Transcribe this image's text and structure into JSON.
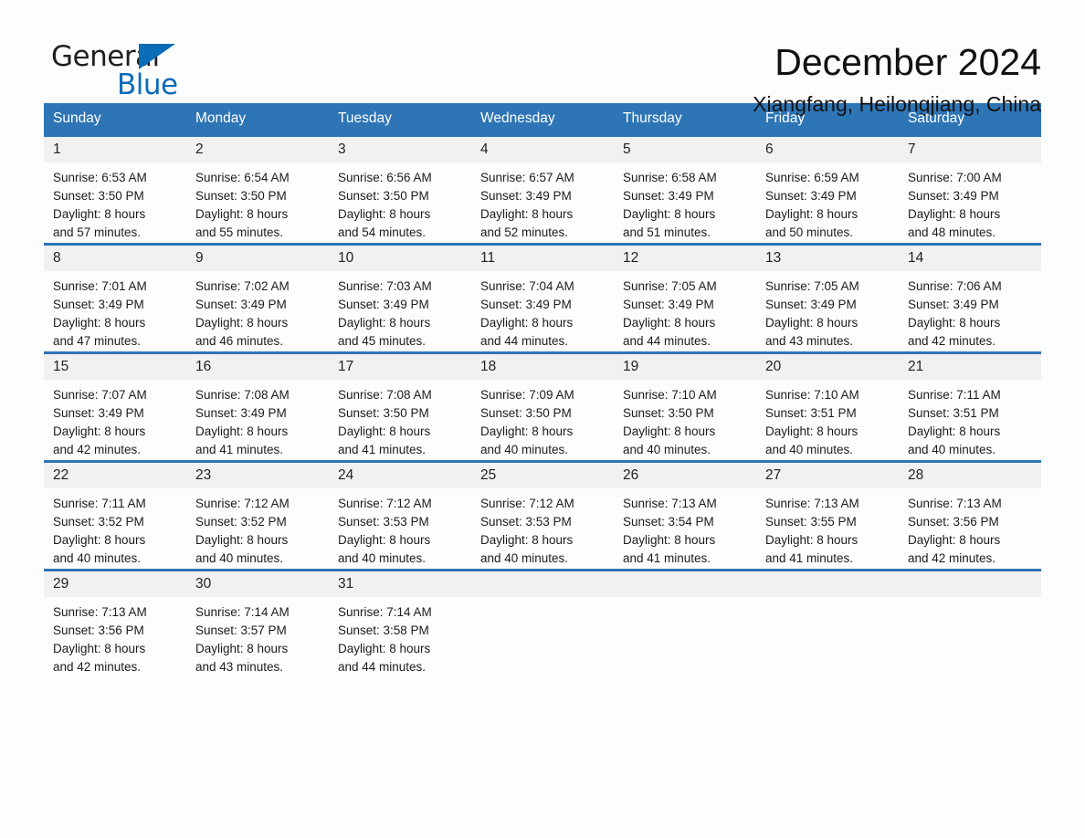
{
  "logo": {
    "word_one": "General",
    "word_two": "Blue",
    "triangle_color": "#0b6cb7"
  },
  "header": {
    "title": "December 2024",
    "location": "Xiangfang, Heilongjiang, China"
  },
  "theme": {
    "header_blue": "#2e75b6",
    "daynum_gray": "#f1f1f1",
    "page_background": "#fdfdfd"
  },
  "calendar": {
    "weekday_headers": [
      "Sunday",
      "Monday",
      "Tuesday",
      "Wednesday",
      "Thursday",
      "Friday",
      "Saturday"
    ],
    "weeks": [
      [
        {
          "day": "1",
          "sunrise": "Sunrise: 6:53 AM",
          "sunset": "Sunset: 3:50 PM",
          "daylight_line1": "Daylight: 8 hours",
          "daylight_line2": "and 57 minutes."
        },
        {
          "day": "2",
          "sunrise": "Sunrise: 6:54 AM",
          "sunset": "Sunset: 3:50 PM",
          "daylight_line1": "Daylight: 8 hours",
          "daylight_line2": "and 55 minutes."
        },
        {
          "day": "3",
          "sunrise": "Sunrise: 6:56 AM",
          "sunset": "Sunset: 3:50 PM",
          "daylight_line1": "Daylight: 8 hours",
          "daylight_line2": "and 54 minutes."
        },
        {
          "day": "4",
          "sunrise": "Sunrise: 6:57 AM",
          "sunset": "Sunset: 3:49 PM",
          "daylight_line1": "Daylight: 8 hours",
          "daylight_line2": "and 52 minutes."
        },
        {
          "day": "5",
          "sunrise": "Sunrise: 6:58 AM",
          "sunset": "Sunset: 3:49 PM",
          "daylight_line1": "Daylight: 8 hours",
          "daylight_line2": "and 51 minutes."
        },
        {
          "day": "6",
          "sunrise": "Sunrise: 6:59 AM",
          "sunset": "Sunset: 3:49 PM",
          "daylight_line1": "Daylight: 8 hours",
          "daylight_line2": "and 50 minutes."
        },
        {
          "day": "7",
          "sunrise": "Sunrise: 7:00 AM",
          "sunset": "Sunset: 3:49 PM",
          "daylight_line1": "Daylight: 8 hours",
          "daylight_line2": "and 48 minutes."
        }
      ],
      [
        {
          "day": "8",
          "sunrise": "Sunrise: 7:01 AM",
          "sunset": "Sunset: 3:49 PM",
          "daylight_line1": "Daylight: 8 hours",
          "daylight_line2": "and 47 minutes."
        },
        {
          "day": "9",
          "sunrise": "Sunrise: 7:02 AM",
          "sunset": "Sunset: 3:49 PM",
          "daylight_line1": "Daylight: 8 hours",
          "daylight_line2": "and 46 minutes."
        },
        {
          "day": "10",
          "sunrise": "Sunrise: 7:03 AM",
          "sunset": "Sunset: 3:49 PM",
          "daylight_line1": "Daylight: 8 hours",
          "daylight_line2": "and 45 minutes."
        },
        {
          "day": "11",
          "sunrise": "Sunrise: 7:04 AM",
          "sunset": "Sunset: 3:49 PM",
          "daylight_line1": "Daylight: 8 hours",
          "daylight_line2": "and 44 minutes."
        },
        {
          "day": "12",
          "sunrise": "Sunrise: 7:05 AM",
          "sunset": "Sunset: 3:49 PM",
          "daylight_line1": "Daylight: 8 hours",
          "daylight_line2": "and 44 minutes."
        },
        {
          "day": "13",
          "sunrise": "Sunrise: 7:05 AM",
          "sunset": "Sunset: 3:49 PM",
          "daylight_line1": "Daylight: 8 hours",
          "daylight_line2": "and 43 minutes."
        },
        {
          "day": "14",
          "sunrise": "Sunrise: 7:06 AM",
          "sunset": "Sunset: 3:49 PM",
          "daylight_line1": "Daylight: 8 hours",
          "daylight_line2": "and 42 minutes."
        }
      ],
      [
        {
          "day": "15",
          "sunrise": "Sunrise: 7:07 AM",
          "sunset": "Sunset: 3:49 PM",
          "daylight_line1": "Daylight: 8 hours",
          "daylight_line2": "and 42 minutes."
        },
        {
          "day": "16",
          "sunrise": "Sunrise: 7:08 AM",
          "sunset": "Sunset: 3:49 PM",
          "daylight_line1": "Daylight: 8 hours",
          "daylight_line2": "and 41 minutes."
        },
        {
          "day": "17",
          "sunrise": "Sunrise: 7:08 AM",
          "sunset": "Sunset: 3:50 PM",
          "daylight_line1": "Daylight: 8 hours",
          "daylight_line2": "and 41 minutes."
        },
        {
          "day": "18",
          "sunrise": "Sunrise: 7:09 AM",
          "sunset": "Sunset: 3:50 PM",
          "daylight_line1": "Daylight: 8 hours",
          "daylight_line2": "and 40 minutes."
        },
        {
          "day": "19",
          "sunrise": "Sunrise: 7:10 AM",
          "sunset": "Sunset: 3:50 PM",
          "daylight_line1": "Daylight: 8 hours",
          "daylight_line2": "and 40 minutes."
        },
        {
          "day": "20",
          "sunrise": "Sunrise: 7:10 AM",
          "sunset": "Sunset: 3:51 PM",
          "daylight_line1": "Daylight: 8 hours",
          "daylight_line2": "and 40 minutes."
        },
        {
          "day": "21",
          "sunrise": "Sunrise: 7:11 AM",
          "sunset": "Sunset: 3:51 PM",
          "daylight_line1": "Daylight: 8 hours",
          "daylight_line2": "and 40 minutes."
        }
      ],
      [
        {
          "day": "22",
          "sunrise": "Sunrise: 7:11 AM",
          "sunset": "Sunset: 3:52 PM",
          "daylight_line1": "Daylight: 8 hours",
          "daylight_line2": "and 40 minutes."
        },
        {
          "day": "23",
          "sunrise": "Sunrise: 7:12 AM",
          "sunset": "Sunset: 3:52 PM",
          "daylight_line1": "Daylight: 8 hours",
          "daylight_line2": "and 40 minutes."
        },
        {
          "day": "24",
          "sunrise": "Sunrise: 7:12 AM",
          "sunset": "Sunset: 3:53 PM",
          "daylight_line1": "Daylight: 8 hours",
          "daylight_line2": "and 40 minutes."
        },
        {
          "day": "25",
          "sunrise": "Sunrise: 7:12 AM",
          "sunset": "Sunset: 3:53 PM",
          "daylight_line1": "Daylight: 8 hours",
          "daylight_line2": "and 40 minutes."
        },
        {
          "day": "26",
          "sunrise": "Sunrise: 7:13 AM",
          "sunset": "Sunset: 3:54 PM",
          "daylight_line1": "Daylight: 8 hours",
          "daylight_line2": "and 41 minutes."
        },
        {
          "day": "27",
          "sunrise": "Sunrise: 7:13 AM",
          "sunset": "Sunset: 3:55 PM",
          "daylight_line1": "Daylight: 8 hours",
          "daylight_line2": "and 41 minutes."
        },
        {
          "day": "28",
          "sunrise": "Sunrise: 7:13 AM",
          "sunset": "Sunset: 3:56 PM",
          "daylight_line1": "Daylight: 8 hours",
          "daylight_line2": "and 42 minutes."
        }
      ],
      [
        {
          "day": "29",
          "sunrise": "Sunrise: 7:13 AM",
          "sunset": "Sunset: 3:56 PM",
          "daylight_line1": "Daylight: 8 hours",
          "daylight_line2": "and 42 minutes."
        },
        {
          "day": "30",
          "sunrise": "Sunrise: 7:14 AM",
          "sunset": "Sunset: 3:57 PM",
          "daylight_line1": "Daylight: 8 hours",
          "daylight_line2": "and 43 minutes."
        },
        {
          "day": "31",
          "sunrise": "Sunrise: 7:14 AM",
          "sunset": "Sunset: 3:58 PM",
          "daylight_line1": "Daylight: 8 hours",
          "daylight_line2": "and 44 minutes."
        },
        {
          "day": "",
          "sunrise": "",
          "sunset": "",
          "daylight_line1": "",
          "daylight_line2": ""
        },
        {
          "day": "",
          "sunrise": "",
          "sunset": "",
          "daylight_line1": "",
          "daylight_line2": ""
        },
        {
          "day": "",
          "sunrise": "",
          "sunset": "",
          "daylight_line1": "",
          "daylight_line2": ""
        },
        {
          "day": "",
          "sunrise": "",
          "sunset": "",
          "daylight_line1": "",
          "daylight_line2": ""
        }
      ]
    ]
  }
}
